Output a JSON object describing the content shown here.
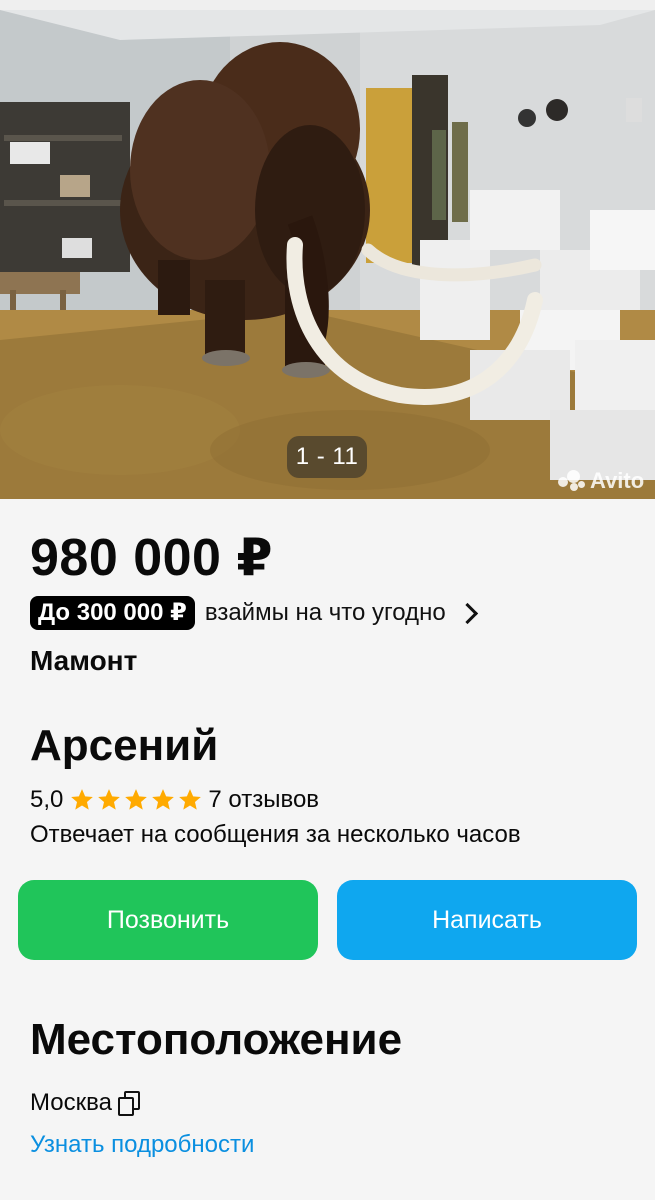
{
  "gallery": {
    "counter": "1 - 11",
    "watermark": "Avito"
  },
  "listing": {
    "price": "980 000 ₽",
    "loan_badge": "До 300 000 ₽",
    "loan_text": "взаймы на что угодно",
    "title": "Мамонт"
  },
  "seller": {
    "name": "Арсений",
    "rating": "5,0",
    "stars": 5,
    "reviews": "7 отзывов",
    "reply_time": "Отвечает на сообщения за несколько часов"
  },
  "actions": {
    "call_label": "Позвонить",
    "write_label": "Написать"
  },
  "location": {
    "heading": "Местоположение",
    "city": "Москва",
    "details_link": "Узнать подробности"
  },
  "colors": {
    "call_button": "#20c55a",
    "write_button": "#0fa7ef",
    "link": "#0a8fe0",
    "star": "#ffaa00",
    "page_background": "#f5f5f5"
  }
}
